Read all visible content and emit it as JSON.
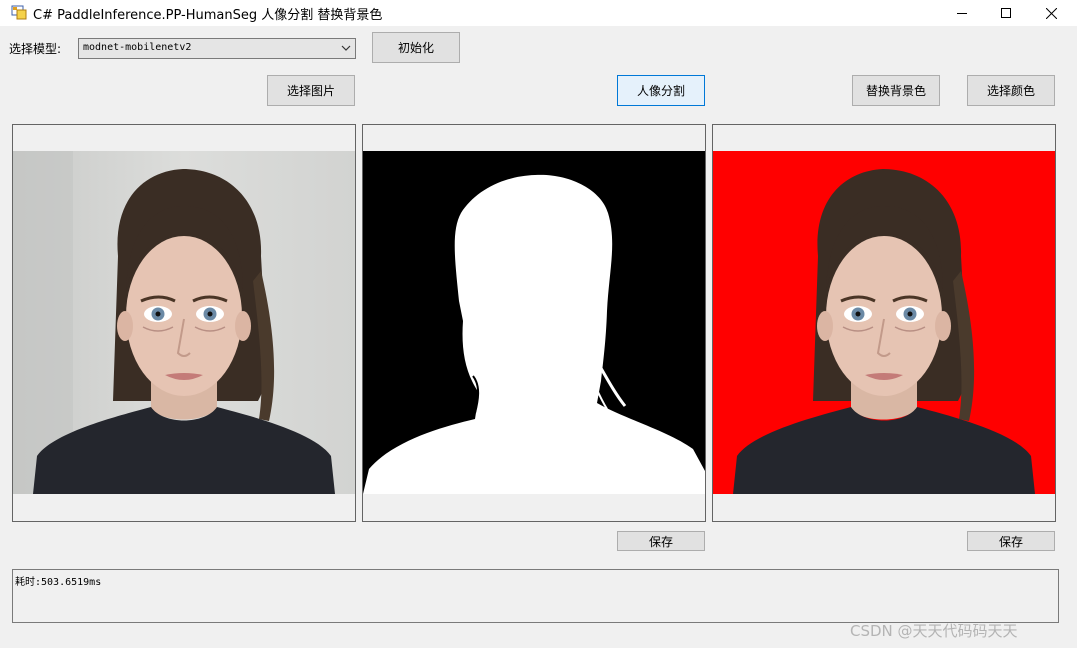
{
  "window": {
    "title": "C# PaddleInference.PP-HumanSeg 人像分割 替换背景色",
    "controls": [
      "minimize-icon",
      "maximize-icon",
      "close-icon"
    ]
  },
  "toolbar": {
    "model_label": "选择模型:",
    "model_selected": "modnet-mobilenetv2",
    "init_button": "初始化",
    "select_image_button": "选择图片",
    "segment_button": "人像分割",
    "replace_bg_button": "替换背景色",
    "select_color_button": "选择颜色"
  },
  "panels": {
    "original": {
      "icon": "portrait-photo"
    },
    "mask": {
      "icon": "silhouette-mask"
    },
    "result": {
      "icon": "portrait-red-background",
      "bg_color": "#ff0000"
    }
  },
  "save_buttons": [
    "保存",
    "保存"
  ],
  "log": {
    "text": "耗时:503.6519ms"
  },
  "watermark": "CSDN @天天代码码天天"
}
